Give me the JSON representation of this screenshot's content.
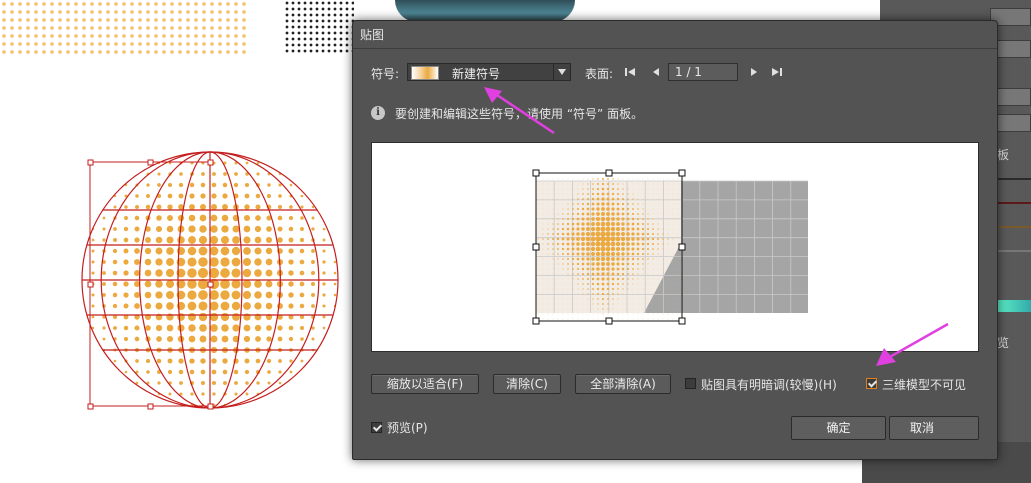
{
  "dialog": {
    "title": "贴图",
    "symbol_label": "符号:",
    "symbol_value": "新建符号",
    "surface_label": "表面:",
    "page_value": "1 / 1",
    "info_text": "要创建和编辑这些符号，请使用 “符号” 面板。",
    "buttons": {
      "fit": "缩放以适合(F)",
      "clear": "清除(C)",
      "clear_all": "全部清除(A)",
      "ok": "确定",
      "cancel": "取消"
    },
    "checkboxes": {
      "shade_artwork": {
        "label": "贴图具有明暗调(较慢)(H)",
        "checked": false
      },
      "invisible_geometry": {
        "label": "三维模型不可见",
        "checked": true
      },
      "preview": {
        "label": "预览(P)",
        "checked": true
      }
    }
  },
  "background_panel": {
    "tab_text_1": "板",
    "tab_text_2": "览"
  },
  "colors": {
    "dialog_bg": "#535353",
    "accent_arrow": "#e040e0",
    "artwork_orange": "#eba93f",
    "selection_red": "#cc1f1f"
  }
}
